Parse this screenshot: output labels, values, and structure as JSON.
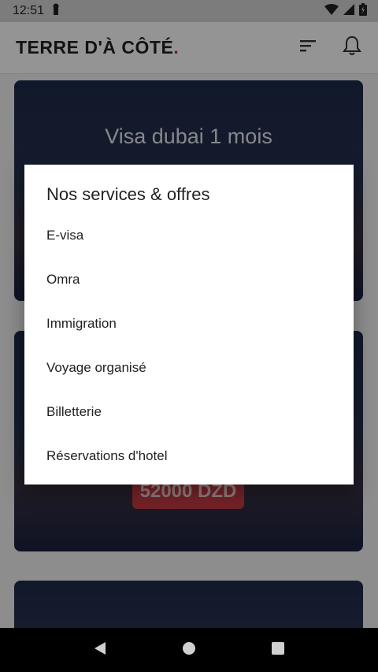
{
  "status_bar": {
    "time": "12:51"
  },
  "app_bar": {
    "brand": "TERRE D'À CÔTÉ",
    "brand_dot": "."
  },
  "cards": [
    {
      "title": "Visa dubai 1 mois"
    },
    {
      "price": "52000 DZD"
    }
  ],
  "dialog": {
    "title": "Nos services & offres",
    "items": [
      {
        "label": "E-visa"
      },
      {
        "label": "Omra"
      },
      {
        "label": "Immigration"
      },
      {
        "label": "Voyage organisé"
      },
      {
        "label": "Billetterie"
      },
      {
        "label": "Réservations d'hotel"
      }
    ]
  },
  "colors": {
    "brand_accent": "#c0392b",
    "price_badge": "#c63b44"
  }
}
